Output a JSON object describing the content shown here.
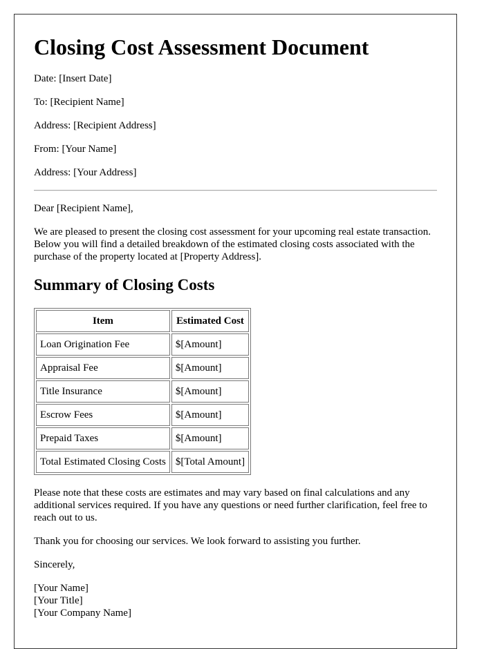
{
  "document": {
    "title": "Closing Cost Assessment Document",
    "header_fields": [
      {
        "label": "Date:",
        "value": "[Insert Date]"
      },
      {
        "label": "To:",
        "value": "[Recipient Name]"
      },
      {
        "label": "Address:",
        "value": "[Recipient Address]"
      },
      {
        "label": "From:",
        "value": "[Your Name]"
      },
      {
        "label": "Address:",
        "value": "[Your Address]"
      }
    ],
    "salutation": "Dear [Recipient Name],",
    "intro": "We are pleased to present the closing cost assessment for your upcoming real estate transaction. Below you will find a detailed breakdown of the estimated closing costs associated with the purchase of the property located at [Property Address].",
    "summary_heading": "Summary of Closing Costs",
    "table": {
      "headers": [
        "Item",
        "Estimated Cost"
      ],
      "rows": [
        [
          "Loan Origination Fee",
          "$[Amount]"
        ],
        [
          "Appraisal Fee",
          "$[Amount]"
        ],
        [
          "Title Insurance",
          "$[Amount]"
        ],
        [
          "Escrow Fees",
          "$[Amount]"
        ],
        [
          "Prepaid Taxes",
          "$[Amount]"
        ],
        [
          "Total Estimated Closing Costs",
          "$[Total Amount]"
        ]
      ]
    },
    "note": "Please note that these costs are estimates and may vary based on final calculations and any additional services required. If you have any questions or need further clarification, feel free to reach out to us.",
    "thanks": "Thank you for choosing our services. We look forward to assisting you further.",
    "closing": "Sincerely,",
    "signature": {
      "name": "[Your Name]",
      "title": "[Your Title]",
      "company": "[Your Company Name]"
    }
  }
}
